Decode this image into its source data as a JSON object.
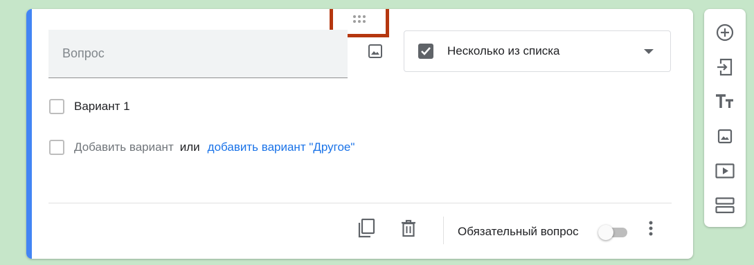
{
  "question": {
    "placeholder": "Вопрос",
    "value": ""
  },
  "type_select": {
    "selected": "Несколько из списка",
    "icon": "checkbox-checked-icon"
  },
  "options": [
    {
      "label": "Вариант 1"
    }
  ],
  "add_option": {
    "label": "Добавить вариант",
    "or": "или",
    "other_link": "добавить вариант \"Другое\""
  },
  "footer": {
    "required_label": "Обязательный вопрос",
    "required_on": false
  },
  "side_toolbar": {
    "items": [
      "add-question-icon",
      "import-questions-icon",
      "add-title-icon",
      "add-image-icon",
      "add-video-icon",
      "add-section-icon"
    ]
  },
  "colors": {
    "accent": "#4285f4",
    "highlight_box": "#b5370f",
    "link": "#1a73e8",
    "background": "#c6e6c9"
  }
}
